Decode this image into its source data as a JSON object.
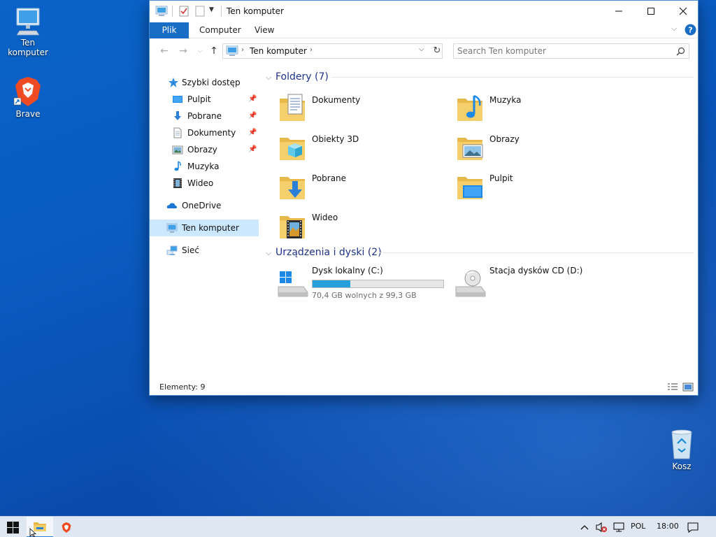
{
  "desktop": {
    "icons": [
      {
        "label": "Ten komputer",
        "icon": "computer-icon"
      },
      {
        "label": "Brave",
        "icon": "brave-icon"
      },
      {
        "label": "Kosz",
        "icon": "recycle-bin-icon"
      }
    ]
  },
  "window": {
    "title": "Ten komputer",
    "ribbon_tabs": [
      "Plik",
      "Computer",
      "View"
    ],
    "address": {
      "segments": [
        "Ten komputer"
      ]
    },
    "search": {
      "placeholder": "Search Ten komputer"
    },
    "nav_pane": {
      "items": [
        {
          "label": "Szybki dostęp",
          "icon": "star-icon",
          "pinned": false
        },
        {
          "label": "Pulpit",
          "icon": "desktop-folder-icon",
          "pinned": true
        },
        {
          "label": "Pobrane",
          "icon": "download-arrow-icon",
          "pinned": true
        },
        {
          "label": "Dokumenty",
          "icon": "document-icon",
          "pinned": true
        },
        {
          "label": "Obrazy",
          "icon": "picture-icon",
          "pinned": true
        },
        {
          "label": "Muzyka",
          "icon": "music-note-icon",
          "pinned": false
        },
        {
          "label": "Wideo",
          "icon": "film-icon",
          "pinned": false
        },
        {
          "label": "OneDrive",
          "icon": "cloud-icon",
          "pinned": false
        },
        {
          "label": "Ten komputer",
          "icon": "computer-icon",
          "pinned": false,
          "selected": true
        },
        {
          "label": "Sieć",
          "icon": "network-icon",
          "pinned": false
        }
      ]
    },
    "folders_group": {
      "title": "Foldery (7)",
      "items": [
        {
          "label": "Dokumenty",
          "icon": "documents-folder-icon"
        },
        {
          "label": "Muzyka",
          "icon": "music-folder-icon"
        },
        {
          "label": "Obiekty 3D",
          "icon": "3d-objects-folder-icon"
        },
        {
          "label": "Obrazy",
          "icon": "pictures-folder-icon"
        },
        {
          "label": "Pobrane",
          "icon": "downloads-folder-icon"
        },
        {
          "label": "Pulpit",
          "icon": "desktop-folder-icon"
        },
        {
          "label": "Wideo",
          "icon": "videos-folder-icon"
        }
      ]
    },
    "drives_group": {
      "title": "Urządzenia i dyski (2)",
      "items": [
        {
          "label": "Dysk lokalny (C:)",
          "icon": "windows-drive-icon",
          "free_text": "70,4 GB wolnych z 99,3 GB",
          "used_fraction": 0.291
        },
        {
          "label": "Stacja dysków CD (D:)",
          "icon": "cd-drive-icon"
        }
      ]
    },
    "status": {
      "text": "Elementy: 9"
    },
    "accent_color": "#1a6dc4"
  },
  "taskbar": {
    "language": "POL",
    "clock": "18:00",
    "items": [
      "start-icon",
      "file-explorer-icon",
      "brave-icon"
    ],
    "tray_icons": [
      "chevron-up-icon",
      "volume-muted-icon",
      "network-icon",
      "notification-icon"
    ]
  }
}
